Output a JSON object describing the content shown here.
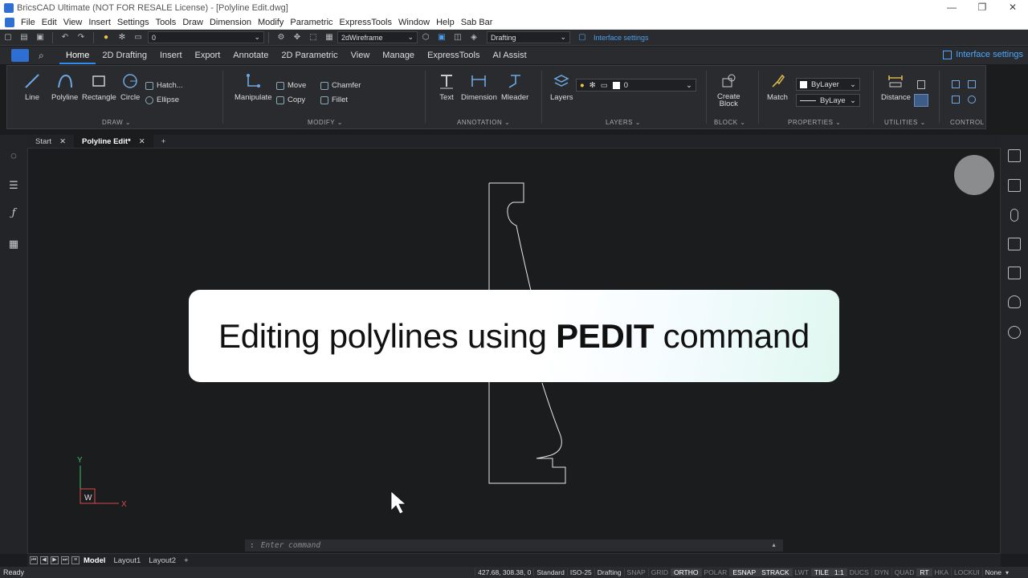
{
  "window": {
    "title": "BricsCAD Ultimate (NOT FOR RESALE License) - [Polyline Edit.dwg]",
    "controls": [
      "—",
      "❐",
      "✕"
    ]
  },
  "menu": [
    "File",
    "Edit",
    "View",
    "Insert",
    "Settings",
    "Tools",
    "Draw",
    "Dimension",
    "Modify",
    "Parametric",
    "ExpressTools",
    "Window",
    "Help",
    "Sab Bar"
  ],
  "qat": {
    "layer_value": "0",
    "visual_style": "2dWireframe",
    "workspace": "Drafting",
    "interface_link": "Interface settings"
  },
  "ribbon_tabs": [
    "Home",
    "2D Drafting",
    "Insert",
    "Export",
    "Annotate",
    "2D Parametric",
    "View",
    "Manage",
    "ExpressTools",
    "AI Assist"
  ],
  "ribbon_tabs_active": "Home",
  "interface_settings": "Interface settings",
  "ribbon": {
    "draw": {
      "label": "DRAW ⌄",
      "line": "Line",
      "polyline": "Polyline",
      "rectangle": "Rectangle",
      "circle": "Circle",
      "hatch": "Hatch...",
      "ellipse": "Ellipse"
    },
    "modify": {
      "label": "MODIFY ⌄",
      "manipulate": "Manipulate",
      "move": "Move",
      "copy": "Copy",
      "chamfer": "Chamfer",
      "fillet": "Fillet"
    },
    "annotation": {
      "label": "ANNOTATION ⌄",
      "text": "Text",
      "dimension": "Dimension",
      "mleader": "Mleader"
    },
    "layers": {
      "label": "LAYERS ⌄",
      "layers": "Layers",
      "current": "0"
    },
    "block": {
      "label": "BLOCK ⌄",
      "create": "Create",
      "create2": "Block"
    },
    "properties": {
      "label": "PROPERTIES ⌄",
      "match": "Match",
      "color": "ByLayer",
      "linetype": "ByLaye"
    },
    "utilities": {
      "label": "UTILITIES ⌄",
      "distance": "Distance"
    },
    "control": {
      "label": "CONTROL"
    }
  },
  "doc_tabs": {
    "start": "Start",
    "active": "Polyline Edit*",
    "close": "✕",
    "add": "+"
  },
  "overlay": {
    "pre": "Editing polylines using ",
    "bold": "PEDIT",
    "post": " command"
  },
  "ucs": {
    "y": "Y",
    "x": "X",
    "w": "W"
  },
  "command_line": {
    "prompt": "Enter command",
    "marker": ":",
    "arrow": "▲"
  },
  "layout_tabs": {
    "model": "Model",
    "layout1": "Layout1",
    "layout2": "Layout2",
    "add": "+"
  },
  "status": {
    "ready": "Ready",
    "coords": "427.68, 308.38, 0",
    "items": [
      {
        "t": "Standard",
        "on": false,
        "val": true
      },
      {
        "t": "ISO-25",
        "on": false,
        "val": true
      },
      {
        "t": "Drafting",
        "on": false,
        "val": true
      },
      {
        "t": "SNAP",
        "on": false
      },
      {
        "t": "GRID",
        "on": false
      },
      {
        "t": "ORTHO",
        "on": true
      },
      {
        "t": "POLAR",
        "on": false
      },
      {
        "t": "ESNAP",
        "on": true
      },
      {
        "t": "STRACK",
        "on": true
      },
      {
        "t": "LWT",
        "on": false
      },
      {
        "t": "TILE",
        "on": true
      },
      {
        "t": "1:1",
        "on": true
      },
      {
        "t": "DUCS",
        "on": false
      },
      {
        "t": "DYN",
        "on": false
      },
      {
        "t": "QUAD",
        "on": false
      },
      {
        "t": "RT",
        "on": true
      },
      {
        "t": "HKA",
        "on": false
      },
      {
        "t": "LOCKUI",
        "on": false
      },
      {
        "t": "None",
        "on": false,
        "val": true
      }
    ]
  },
  "colors": {
    "accent": "#2f8cf0",
    "canvas": "#1b1c1e",
    "link": "#4aa8ff"
  }
}
